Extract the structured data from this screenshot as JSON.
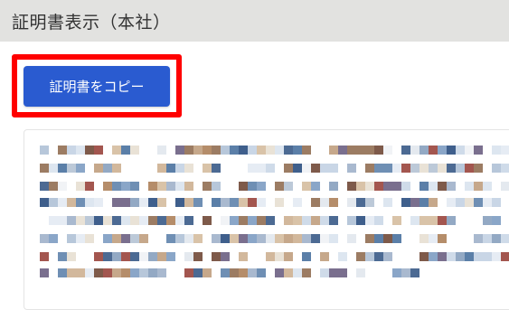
{
  "header": {
    "title": "証明書表示（本社）"
  },
  "toolbar": {
    "copy_label": "証明書をコピー"
  },
  "colors": {
    "header_bg": "#e2e2e0",
    "button_bg": "#2a5bd0",
    "highlight": "#ff0000"
  },
  "certificate": {
    "content_state": "pixelated"
  }
}
